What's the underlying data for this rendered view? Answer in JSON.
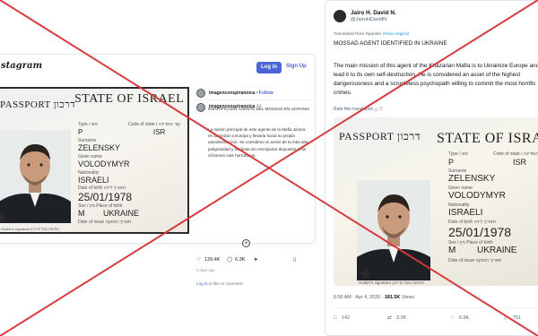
{
  "instagram": {
    "logo": "stagram",
    "login_label": "Log in",
    "signup_label": "Sign Up",
    "account_top": "imagenconspiranoica",
    "follow_label": "• Follow",
    "account_post": "imagenconspiranoica",
    "post_age": "4d",
    "caption_title": "IDENTIFICADO AGENTE DEL MOSSAD EN UCRANIA",
    "caption_body": "La misión principal de este agente de la Mafia Jázara es ucranizar a Europa y llevarla hacia su propia autodestrucción. Se considera un activo de la más alta peligrosidad y sicópata sin escrúpulos dispuesto a los crímenes más horrorosos.",
    "likes": "139.4K",
    "comments": "6.3K",
    "ago": "4 days ago",
    "login_prompt_link": "Log in",
    "login_prompt_rest": "to like or comment."
  },
  "tweet": {
    "author_name": "Jairo H. David N.",
    "author_handle": "@JairoHDavidN",
    "translated_label": "Translated from Spanish",
    "show_original": "Show original",
    "headline": "MOSSAD AGENT IDENTIFIED IN UKRAINE",
    "body": "The main mission of this agent of the Khazarian Mafia is to Ukrainize Europe and lead it to its own self-destruction. He is considered an asset of the highest dangerousness and a scrupleless psychopath willing to commit the most horrific crimes.",
    "rate_label": "Rate this translation",
    "time": "6:56 AM · Apr 4, 2026 ·",
    "views": "181.5K",
    "views_label": "Views",
    "replies": "142",
    "reposts": "3.2K",
    "likes": "6.9K",
    "bookmarks": "751"
  },
  "passport": {
    "state": "STATE OF ISRAEL",
    "passport_word": "PASSPORT",
    "passport_hebrew": "דרכון",
    "type_label": "Type / סוג",
    "type_value": "P",
    "code_label": "Code of state / קוד המדינה",
    "code_value": "ISR",
    "surname_label": "Surname",
    "surname_value": "ZELENSKY",
    "given_label": "Given name",
    "given_value": "VOLODYMYR",
    "nationality_label": "Nationality",
    "nationality_value": "ISRAELI",
    "dob_label": "Date of birth  תאריך לידה",
    "dob_value": "25/01/1978",
    "sex_label": "Sex / מין  Place of birth",
    "sex_value": "M",
    "pob_value": "UKRAINE",
    "issue_label": "Date of issue  תאריך הנפקה",
    "holder_label": "Holder's signature  חתימת בעל הדרכון"
  },
  "colors": {
    "cross_red": "#d8363a",
    "accent_blue": "#4a63d9",
    "twitter_blue": "#1d9bf0"
  }
}
